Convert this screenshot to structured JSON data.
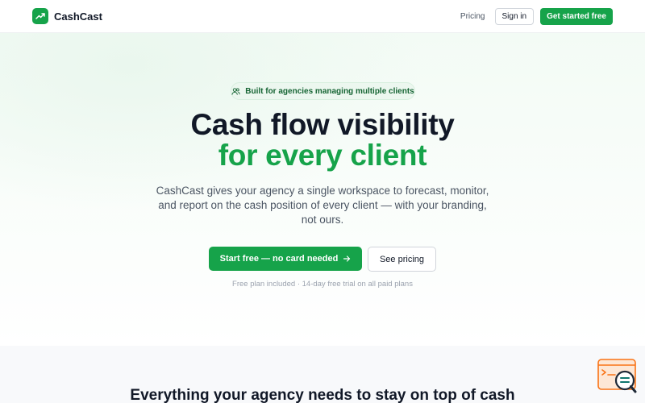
{
  "nav": {
    "brand": "CashCast",
    "pricing": "Pricing",
    "signin": "Sign in",
    "get_started": "Get started free"
  },
  "hero": {
    "badge": "Built for agencies managing multiple clients",
    "title_line1": "Cash flow visibility",
    "title_line2": "for every client",
    "subtitle": "CashCast gives your agency a single workspace to forecast, monitor, and report on the cash position of every client — with your branding, not ours.",
    "cta_primary": "Start free — no card needed",
    "cta_secondary": "See pricing",
    "note": "Free plan included · 14-day free trial on all paid plans"
  },
  "features": {
    "title": "Everything your agency needs to stay on top of cash"
  },
  "colors": {
    "accent": "#16a34a",
    "widget": "#f97316"
  },
  "icons": {
    "logo": "trending-up-icon",
    "badge": "users-icon",
    "cta": "arrow-right-icon",
    "widget": "chat-search-icon"
  }
}
